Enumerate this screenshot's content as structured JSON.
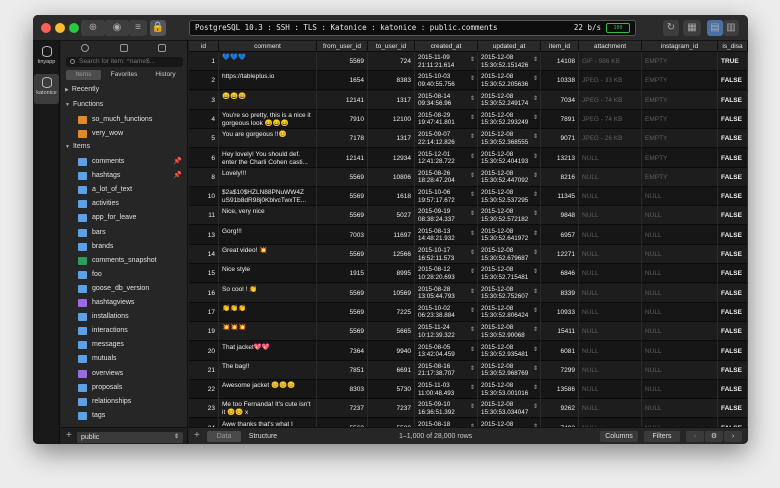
{
  "connection": {
    "text": "PostgreSQL 10.3 : SSH : TLS : Katonice : katonice : public.comments",
    "speed": "22 b/s",
    "battery": "100"
  },
  "databases": [
    {
      "name": "tinyapp"
    },
    {
      "name": "katonice"
    }
  ],
  "sidebar": {
    "search_placeholder": "Search for item: ^name$...",
    "tabs": [
      "Items",
      "Favorites",
      "History"
    ],
    "recently": "Recently",
    "functions_header": "Functions",
    "functions": [
      "so_much_functions",
      "very_wow"
    ],
    "items_header": "Items",
    "items": [
      {
        "name": "comments",
        "kind": "table",
        "pinned": true
      },
      {
        "name": "hashtags",
        "kind": "table",
        "pinned": true
      },
      {
        "name": "a_lot_of_text",
        "kind": "table"
      },
      {
        "name": "activities",
        "kind": "table"
      },
      {
        "name": "app_for_leave",
        "kind": "table"
      },
      {
        "name": "bars",
        "kind": "table"
      },
      {
        "name": "brands",
        "kind": "table"
      },
      {
        "name": "comments_snapshot",
        "kind": "mview"
      },
      {
        "name": "foo",
        "kind": "table"
      },
      {
        "name": "goose_db_version",
        "kind": "table"
      },
      {
        "name": "hashtagviews",
        "kind": "view"
      },
      {
        "name": "installations",
        "kind": "table"
      },
      {
        "name": "interactions",
        "kind": "table"
      },
      {
        "name": "messages",
        "kind": "table"
      },
      {
        "name": "mutuals",
        "kind": "table"
      },
      {
        "name": "overviews",
        "kind": "view"
      },
      {
        "name": "proposals",
        "kind": "table"
      },
      {
        "name": "relationships",
        "kind": "table"
      },
      {
        "name": "tags",
        "kind": "table"
      }
    ],
    "schema": "public"
  },
  "table": {
    "columns": [
      "id",
      "comment",
      "from_user_id",
      "to_user_id",
      "created_at",
      "updated_at",
      "item_id",
      "attachment",
      "instagram_id",
      "is_disa"
    ],
    "rows": [
      {
        "id": "1",
        "comment": "💙💙💙",
        "from": "5569",
        "to": "724",
        "c1": "2015-11-09",
        "c2": "21:11:21.614",
        "u1": "2015-12-08",
        "u2": "15:30:52.151426",
        "item": "14108",
        "att": "GIF - 986 KB",
        "ig": "EMPTY",
        "dis": "TRUE"
      },
      {
        "id": "2",
        "comment": "https://tableplus.io",
        "from": "1654",
        "to": "8383",
        "c1": "2015-10-03",
        "c2": "09:40:55.756",
        "u1": "2015-12-08",
        "u2": "15:30:52.205636",
        "item": "10338",
        "att": "JPEG - 33 KB",
        "ig": "EMPTY",
        "dis": "FALSE"
      },
      {
        "id": "3",
        "comment": "😄😄😄",
        "from": "12141",
        "to": "1317",
        "c1": "2015-08-14",
        "c2": "09:34:56.96",
        "u1": "2015-12-08",
        "u2": "15:30:52.249174",
        "item": "7034",
        "att": "JPEG - 74 KB",
        "ig": "EMPTY",
        "dis": "FALSE"
      },
      {
        "id": "4",
        "comment": "You're so pretty, this is a nice it gorgeous look 😄😄😄",
        "from": "7910",
        "to": "12100",
        "c1": "2015-08-29",
        "c2": "19:47:41.801",
        "u1": "2015-12-08",
        "u2": "15:30:52.293249",
        "item": "7891",
        "att": "JPEG - 74 KB",
        "ig": "EMPTY",
        "dis": "FALSE"
      },
      {
        "id": "5",
        "comment": "You are gorgeous !!😊",
        "from": "7178",
        "to": "1317",
        "c1": "2015-09-07",
        "c2": "22:14:12.826",
        "u1": "2015-12-08",
        "u2": "15:30:52.368555",
        "item": "9071",
        "att": "JPEG - 26 KB",
        "ig": "EMPTY",
        "dis": "FALSE"
      },
      {
        "id": "6",
        "comment": "Hey lovely! You should def. enter the Charli Cohen casti...",
        "from": "12141",
        "to": "12934",
        "c1": "2015-12-01",
        "c2": "12:41:28.722",
        "u1": "2015-12-08",
        "u2": "15:30:52.404193",
        "item": "13213",
        "att": "NULL",
        "ig": "EMPTY",
        "dis": "FALSE"
      },
      {
        "id": "8",
        "comment": "Lovely!!!",
        "from": "5569",
        "to": "10806",
        "c1": "2015-08-26",
        "c2": "18:28:47.204",
        "u1": "2015-12-08",
        "u2": "15:30:52.447092",
        "item": "8216",
        "att": "NULL",
        "ig": "EMPTY",
        "dis": "FALSE"
      },
      {
        "id": "10",
        "comment": "$2a$10$HZLN88PNuWW4Z uS91b8dR98j0KblvcTwxTE...",
        "from": "5569",
        "to": "1618",
        "c1": "2015-10-06",
        "c2": "19:57:17.672",
        "u1": "2015-12-08",
        "u2": "15:30:52.537295",
        "item": "11345",
        "att": "NULL",
        "ig": "NULL",
        "dis": "FALSE"
      },
      {
        "id": "11",
        "comment": "Nice, very nice",
        "from": "5569",
        "to": "5027",
        "c1": "2015-09-19",
        "c2": "08:38:24.337",
        "u1": "2015-12-08",
        "u2": "15:30:52.572182",
        "item": "9848",
        "att": "NULL",
        "ig": "NULL",
        "dis": "FALSE"
      },
      {
        "id": "13",
        "comment": "Gorg!!!",
        "from": "7003",
        "to": "11697",
        "c1": "2015-08-13",
        "c2": "14:48:21.932",
        "u1": "2015-12-08",
        "u2": "15:30:52.641972",
        "item": "6957",
        "att": "NULL",
        "ig": "NULL",
        "dis": "FALSE"
      },
      {
        "id": "14",
        "comment": "Great video! 💥",
        "from": "5569",
        "to": "12566",
        "c1": "2015-10-17",
        "c2": "16:52:11.573",
        "u1": "2015-12-08",
        "u2": "15:30:52.679687",
        "item": "12271",
        "att": "NULL",
        "ig": "NULL",
        "dis": "FALSE"
      },
      {
        "id": "15",
        "comment": "Nice style",
        "from": "1915",
        "to": "8995",
        "c1": "2015-08-12",
        "c2": "10:28:20.693",
        "u1": "2015-12-08",
        "u2": "15:30:52.715481",
        "item": "6846",
        "att": "NULL",
        "ig": "NULL",
        "dis": "FALSE"
      },
      {
        "id": "16",
        "comment": "So cool ! 👏",
        "from": "5569",
        "to": "10569",
        "c1": "2015-08-28",
        "c2": "13:05:44.793",
        "u1": "2015-12-08",
        "u2": "15:30:52.752607",
        "item": "8339",
        "att": "NULL",
        "ig": "NULL",
        "dis": "FALSE"
      },
      {
        "id": "17",
        "comment": "👏👏👏",
        "from": "5569",
        "to": "7225",
        "c1": "2015-10-02",
        "c2": "06:23:38.884",
        "u1": "2015-12-08",
        "u2": "15:30:52.806424",
        "item": "10933",
        "att": "NULL",
        "ig": "NULL",
        "dis": "FALSE"
      },
      {
        "id": "19",
        "comment": "💥💥💥",
        "from": "5569",
        "to": "5665",
        "c1": "2015-11-24",
        "c2": "10:12:39.322",
        "u1": "2015-12-08",
        "u2": "15:30:52.90068",
        "item": "15411",
        "att": "NULL",
        "ig": "NULL",
        "dis": "FALSE"
      },
      {
        "id": "20",
        "comment": "That jacket💖💖",
        "from": "7364",
        "to": "9940",
        "c1": "2015-08-05",
        "c2": "13:42:04.459",
        "u1": "2015-12-08",
        "u2": "15:30:52.935481",
        "item": "6081",
        "att": "NULL",
        "ig": "NULL",
        "dis": "FALSE"
      },
      {
        "id": "21",
        "comment": "The bag!!",
        "from": "7851",
        "to": "6691",
        "c1": "2015-08-16",
        "c2": "21:17:38.707",
        "u1": "2015-12-08",
        "u2": "15:30:52.968769",
        "item": "7299",
        "att": "NULL",
        "ig": "NULL",
        "dis": "FALSE"
      },
      {
        "id": "22",
        "comment": "Awesome jacket 😊😊😊",
        "from": "8303",
        "to": "5730",
        "c1": "2015-11-03",
        "c2": "11:00:48.493",
        "u1": "2015-12-08",
        "u2": "15:30:53.001016",
        "item": "13586",
        "att": "NULL",
        "ig": "NULL",
        "dis": "FALSE"
      },
      {
        "id": "23",
        "comment": "Me too Fernanda! It's cute isn't it 😊😊 x",
        "from": "7237",
        "to": "7237",
        "c1": "2015-09-10",
        "c2": "16:36:51.392",
        "u1": "2015-12-08",
        "u2": "15:30:53.034047",
        "item": "9262",
        "att": "NULL",
        "ig": "NULL",
        "dis": "FALSE"
      },
      {
        "id": "24",
        "comment": "Aww thanks that's what I",
        "from": "5569",
        "to": "5580",
        "c1": "2015-08-18",
        "c2": "",
        "u1": "2015-12-08",
        "u2": "",
        "item": "7492",
        "att": "NULL",
        "ig": "NULL",
        "dis": "FALSE"
      }
    ]
  },
  "footer": {
    "tab_data": "Data",
    "tab_structure": "Structure",
    "row_count": "1–1,000 of 28,000 rows",
    "columns_button": "Columns",
    "filters_button": "Filters"
  }
}
